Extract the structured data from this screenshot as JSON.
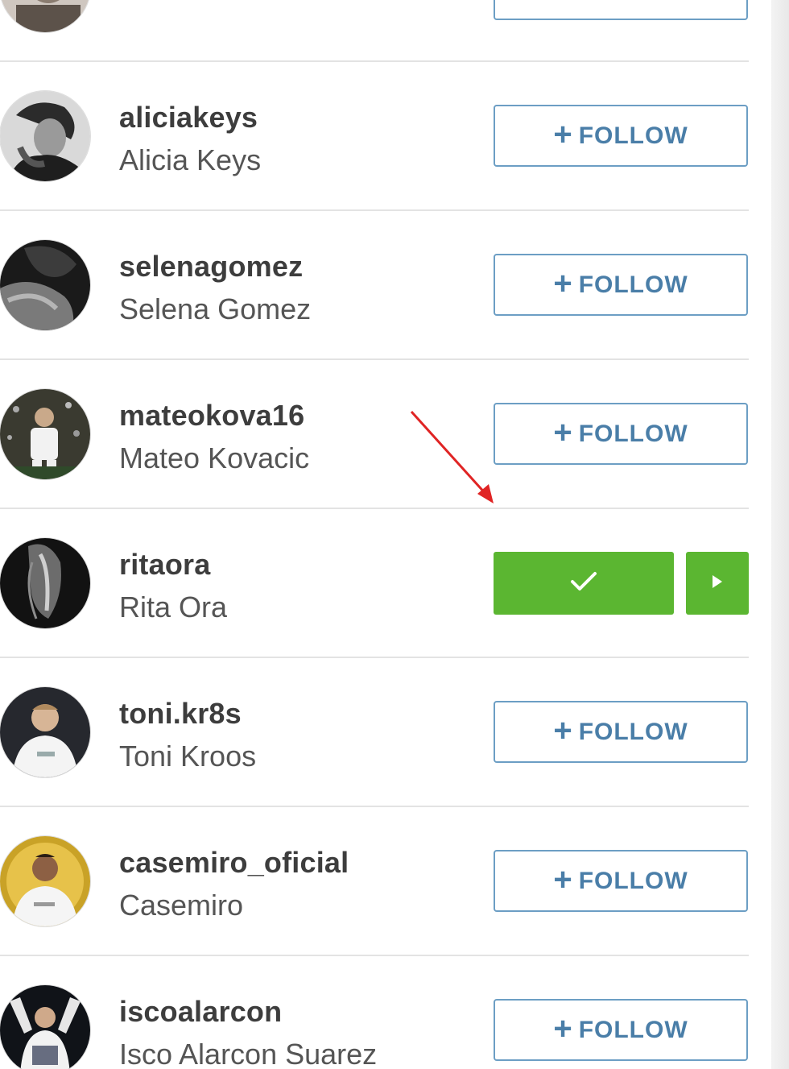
{
  "follow_button": {
    "plus": "+",
    "label": "FOLLOW"
  },
  "users": [
    {
      "username": "aliciakeys",
      "full_name": "Alicia Keys",
      "state": "follow"
    },
    {
      "username": "selenagomez",
      "full_name": "Selena Gomez",
      "state": "follow"
    },
    {
      "username": "mateokova16",
      "full_name": "Mateo Kovacic",
      "state": "follow"
    },
    {
      "username": "ritaora",
      "full_name": "Rita Ora",
      "state": "following"
    },
    {
      "username": "toni.kr8s",
      "full_name": "Toni Kroos",
      "state": "follow"
    },
    {
      "username": "casemiro_oficial",
      "full_name": "Casemiro",
      "state": "follow"
    },
    {
      "username": "iscoalarcon",
      "full_name": "Isco Alarcon Suarez",
      "state": "follow"
    }
  ],
  "colors": {
    "follow_border": "#6c9ec4",
    "follow_text": "#4a7ea8",
    "following_green": "#5bb631",
    "annotation_arrow": "#e02424"
  },
  "icons": {
    "following": "checkmark-icon",
    "more": "play-triangle-icon",
    "annotation": "red-arrow-annotation"
  }
}
